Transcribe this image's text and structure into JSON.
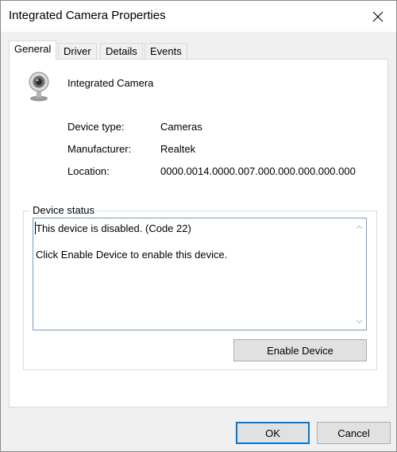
{
  "window": {
    "title": "Integrated Camera Properties"
  },
  "icons": {
    "close": "close-icon",
    "device": "webcam-icon",
    "scroll_up": "chevron-up-icon",
    "scroll_down": "chevron-down-icon"
  },
  "tabs": [
    {
      "label": "General",
      "active": true
    },
    {
      "label": "Driver",
      "active": false
    },
    {
      "label": "Details",
      "active": false
    },
    {
      "label": "Events",
      "active": false
    }
  ],
  "general": {
    "device_name": "Integrated Camera",
    "properties": [
      {
        "label": "Device type:",
        "value": "Cameras"
      },
      {
        "label": "Manufacturer:",
        "value": "Realtek"
      },
      {
        "label": "Location:",
        "value": "0000.0014.0000.007.000.000.000.000.000"
      }
    ],
    "device_status": {
      "title": "Device status",
      "line1": "This device is disabled. (Code 22)",
      "line2": "Click Enable Device to enable this device."
    },
    "enable_button": "Enable Device"
  },
  "footer": {
    "ok": "OK",
    "cancel": "Cancel"
  },
  "colors": {
    "accent": "#0078d7",
    "panel_bg": "#ffffff",
    "window_bg": "#f0f0f0"
  }
}
